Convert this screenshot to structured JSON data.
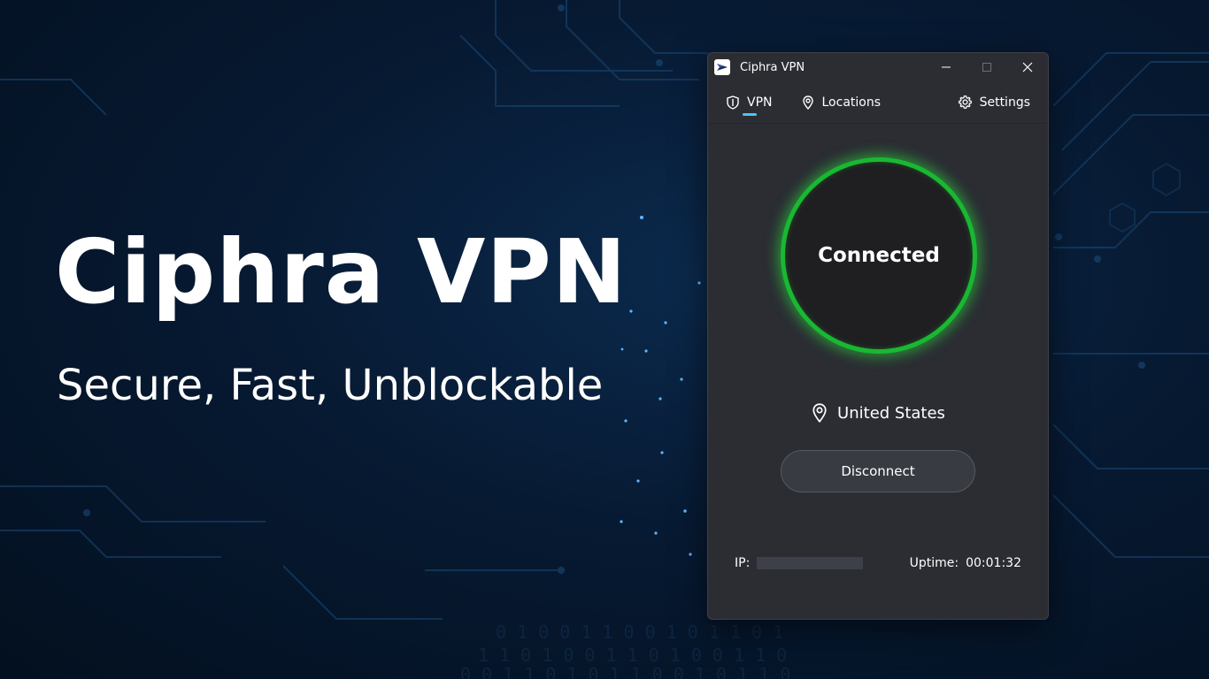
{
  "hero": {
    "title": "Ciphra VPN",
    "subtitle": "Secure, Fast, Unblockable"
  },
  "window": {
    "title": "Ciphra VPN",
    "icon": "paper-plane-logo",
    "controls": [
      "minimize-icon",
      "maximize-icon",
      "close-icon"
    ]
  },
  "nav": {
    "tabs": [
      {
        "label": "VPN",
        "icon": "shield-icon",
        "active": true
      },
      {
        "label": "Locations",
        "icon": "map-pin-icon",
        "active": false
      },
      {
        "label": "Settings",
        "icon": "gear-icon",
        "active": false
      }
    ]
  },
  "status": {
    "text": "Connected",
    "ring_color": "#19b832"
  },
  "location": {
    "name": "United States",
    "icon": "map-pin-icon"
  },
  "actions": {
    "disconnect_label": "Disconnect"
  },
  "info": {
    "ip_label": "IP:",
    "uptime_label": "Uptime:",
    "uptime_value": "00:01:32"
  },
  "colors": {
    "accent": "#4cc2ff",
    "window_bg": "#2b2d33",
    "connected_green": "#19b832"
  }
}
